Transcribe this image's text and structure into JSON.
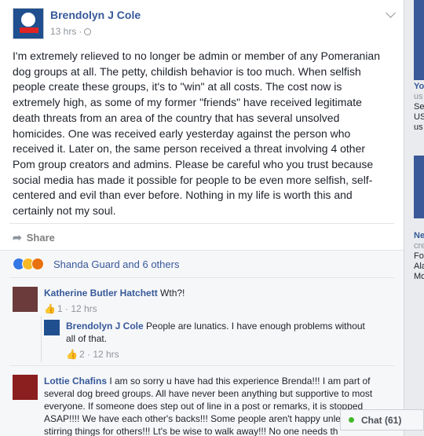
{
  "post": {
    "author": "Brendolyn J Cole",
    "time": "13 hrs",
    "text": "I'm extremely relieved to no longer be admin or member of any Pomeranian dog groups at all. The petty, childish behavior is too much. When selfish people create these groups, it's to \"win\" at all costs. The cost now is extremely high, as some of my former \"friends\" have received legitimate death threats from an area of the country that has several unsolved homicides. One was received early yesterday against the person who received it. Later on, the same person received a threat involving 4 other Pom group creators and admins. Please be careful who you trust because social media has made it possible for people to be even more selfish, self-centered and evil than ever before. Nothing in my life is worth this and certainly not my soul.",
    "share_label": "Share",
    "reactions_text": "Shanda Guard and 6 others"
  },
  "comments": [
    {
      "name": "Katherine Butler Hatchett",
      "text": "Wth?!",
      "likes": "1",
      "time": "12 hrs"
    },
    {
      "name": "Brendolyn J Cole",
      "text": "People are lunatics. I have enough problems without all of that.",
      "likes": "2",
      "time": "12 hrs"
    },
    {
      "name": "Lottie Chafins",
      "text": "I am so sorry u have had this experience Brenda!!! I am part of several dog breed groups. All have never been anything but supportive to most everyone. If someone does step out of line in a post or remarks, it is stopped ASAP!!!! We have each other's backs!!! Some people aren't happy unless they are stirring things for others!!! Lt's be wise to walk away!!! No one needs th"
    }
  ],
  "chat": {
    "label": "Chat (61)"
  },
  "right_column": {
    "lines_1": [
      "Yo",
      "us"
    ],
    "lines_2": [
      "Se",
      "US",
      "us"
    ],
    "lines_3": [
      "Ne",
      "cre"
    ],
    "lines_4": [
      "Fo",
      "Ala",
      "Mo"
    ]
  },
  "colors": {
    "link_blue": "#365899",
    "background": "#e9ebee",
    "online_green": "#42b72a"
  }
}
